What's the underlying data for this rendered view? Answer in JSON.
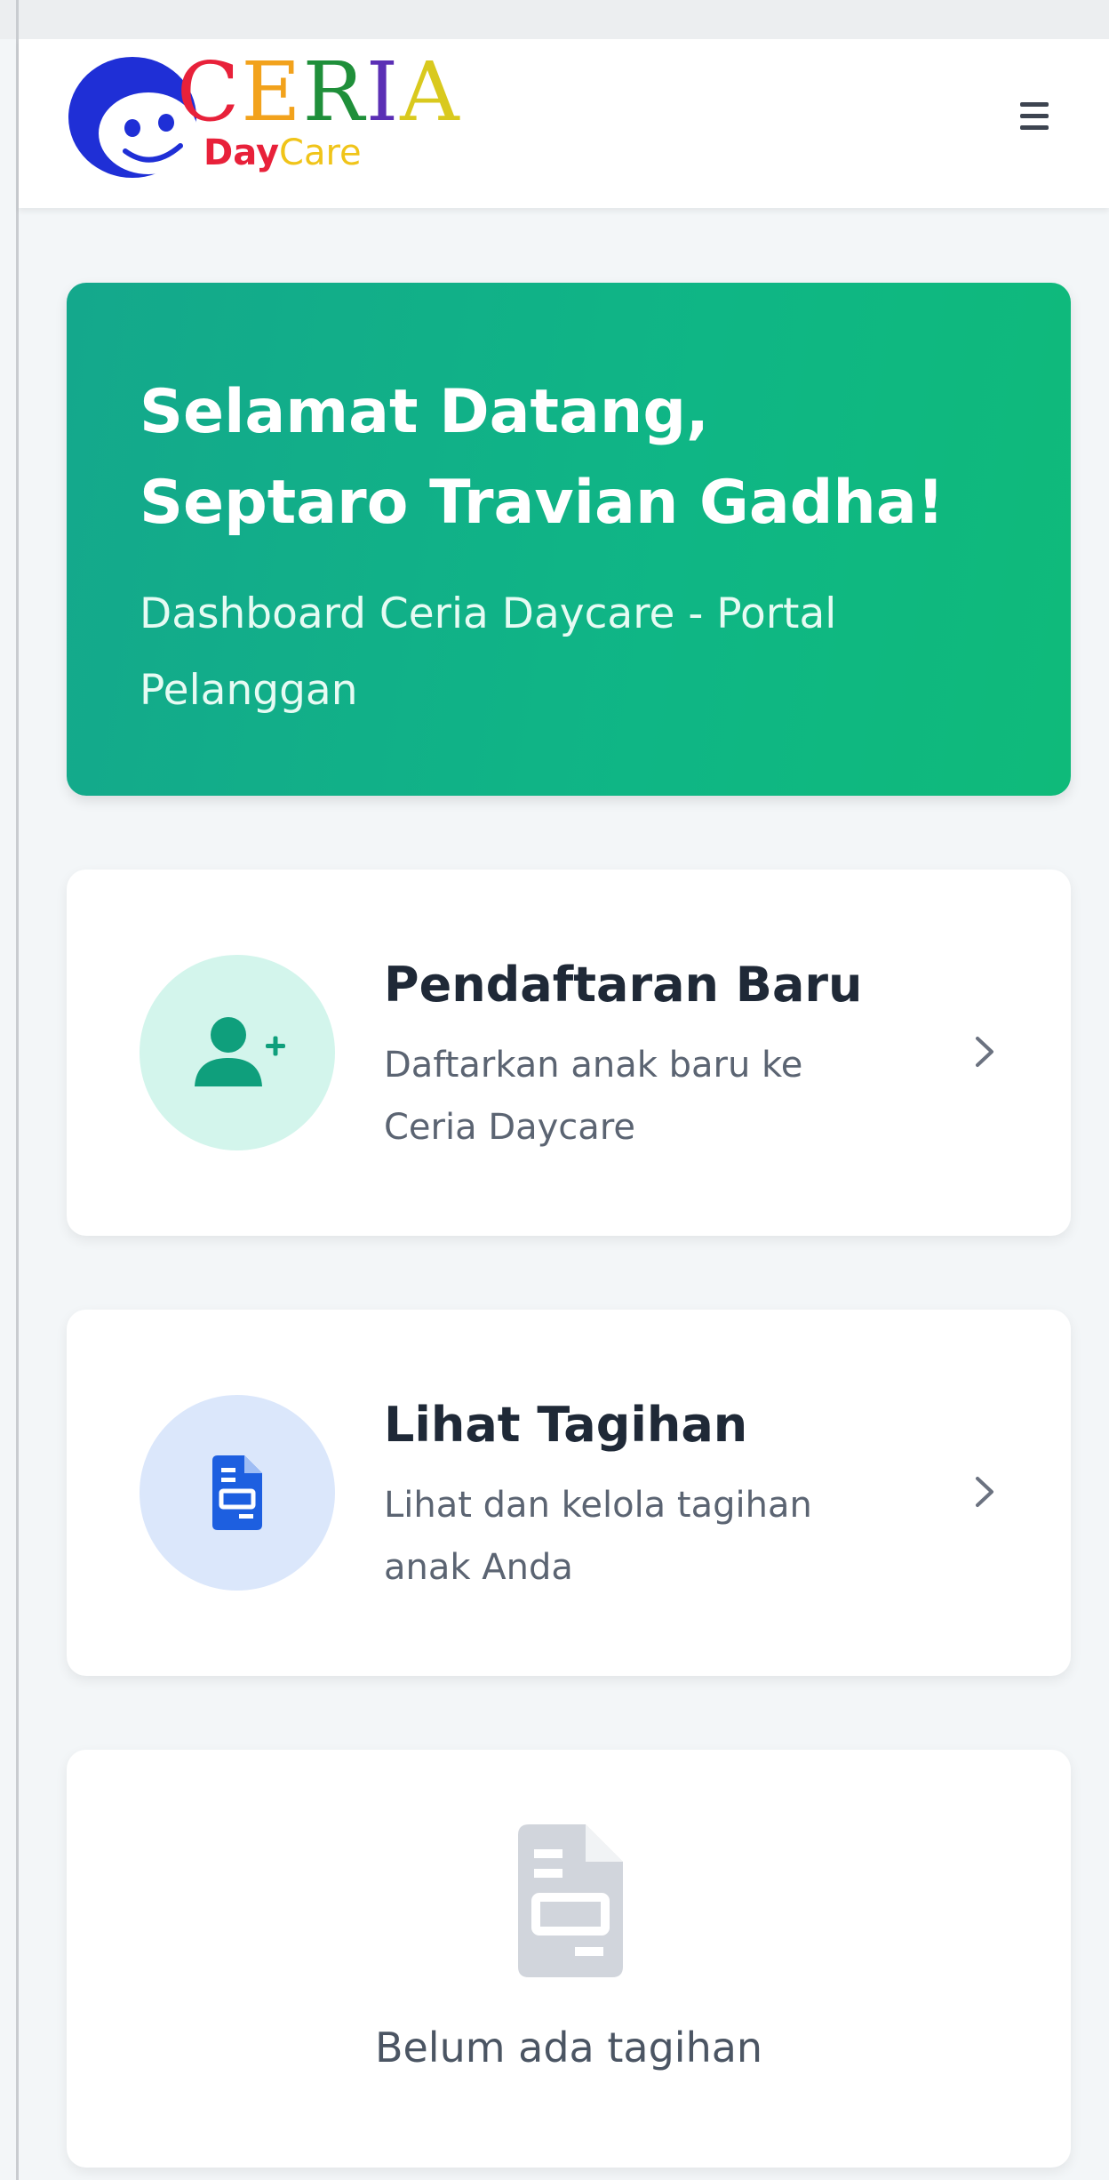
{
  "logo": {
    "brand_letters": [
      "C",
      "E",
      "R",
      "I",
      "A"
    ],
    "brand_colors": [
      "#e8213a",
      "#f2a21c",
      "#1f8f3a",
      "#5b2fb5",
      "#d9c91e"
    ],
    "sub_day": "Day",
    "sub_care": "Care",
    "sub_day_color": "#e8213a",
    "sub_care_color": "#f0c419",
    "icon": "smiling-face-icon"
  },
  "navbar": {
    "menu_icon": "hamburger-menu-icon"
  },
  "welcome": {
    "title_line1": "Selamat Datang,",
    "title_line2": "Septaro Travian Gadha!",
    "subtitle": "Dashboard Ceria Daycare - Portal Pelanggan",
    "gradient": [
      "#14a88c",
      "#0fba7a"
    ]
  },
  "actions": [
    {
      "title": "Pendaftaran Baru",
      "description": "Daftarkan anak baru ke Ceria Daycare",
      "icon": "user-plus-icon",
      "icon_color": "#0f9f7c",
      "icon_bg": "#d3f5ec"
    },
    {
      "title": "Lihat Tagihan",
      "description": "Lihat dan kelola tagihan anak Anda",
      "icon": "invoice-icon",
      "icon_color": "#1d5fe0",
      "icon_bg": "#dbe7fb"
    }
  ],
  "empty_state": {
    "icon": "invoice-icon",
    "message": "Belum ada tagihan"
  }
}
